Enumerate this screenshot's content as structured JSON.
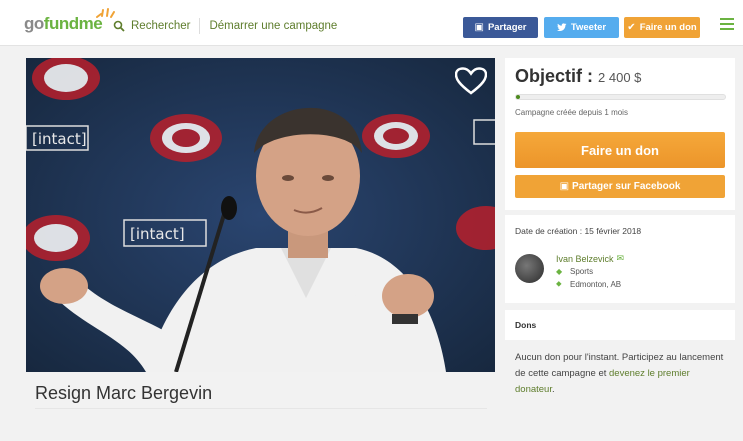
{
  "header": {
    "logo": {
      "go": "go",
      "fund": "fund",
      "me": "me"
    },
    "search_label": "Rechercher",
    "start_campaign": "Démarrer une campagne",
    "share_facebook": "Partager",
    "share_twitter": "Tweeter",
    "donate": "Faire un don",
    "colors": {
      "facebook": "#3b5998",
      "twitter": "#55acee",
      "donate": "#f0a336",
      "brand": "#6bb341"
    }
  },
  "campaign": {
    "title": "Resign Marc Bergevin",
    "goal_label": "Objectif :",
    "goal_amount": "2 400 $",
    "progress": 0.02,
    "created_ago": "Campagne créée depuis 1 mois",
    "donate_button": "Faire un don",
    "facebook_share_button": "Partager sur Facebook",
    "creation_date": "Date de création : 15 février 2018",
    "organizer": {
      "name": "Ivan Belzevick",
      "category": "Sports",
      "location": "Edmonton, AB"
    }
  },
  "donations": {
    "title": "Dons",
    "empty_text_1": "Aucun don pour l'instant. Participez au lancement de cette campagne et ",
    "empty_link": "devenez le premier donateur",
    "empty_text_2": "."
  },
  "hero_image": {
    "banner_text": "[intact]",
    "icons": [
      "heart-icon"
    ]
  }
}
